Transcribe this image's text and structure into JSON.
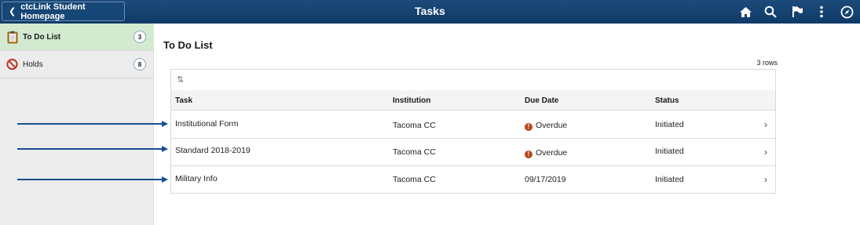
{
  "header": {
    "back_label": "ctcLink Student Homepage",
    "title": "Tasks",
    "icons": [
      "home-icon",
      "search-icon",
      "flag-icon",
      "more-icon",
      "navigator-icon"
    ],
    "bar_color": "#14426f"
  },
  "sidebar": {
    "items": [
      {
        "label": "To Do List",
        "count": "3",
        "icon": "clipboard-icon",
        "active": true
      },
      {
        "label": "Holds",
        "count": "8",
        "icon": "no-entry-icon",
        "active": false
      }
    ]
  },
  "main": {
    "title": "To Do List",
    "rows_count": "3 rows",
    "columns": [
      "Task",
      "Institution",
      "Due Date",
      "Status"
    ],
    "rows": [
      {
        "task": "Institutional Form",
        "institution": "Tacoma CC",
        "due_date": "Overdue",
        "overdue": true,
        "status": "Initiated"
      },
      {
        "task": "Standard 2018-2019",
        "institution": "Tacoma CC",
        "due_date": "Overdue",
        "overdue": true,
        "status": "Initiated"
      },
      {
        "task": "Military Info",
        "institution": "Tacoma CC",
        "due_date": "09/17/2019",
        "overdue": false,
        "status": "Initiated"
      }
    ]
  },
  "colors": {
    "active_tab": "#d3ead0",
    "overdue": "#b5471b",
    "arrow": "#1a4f8f"
  }
}
